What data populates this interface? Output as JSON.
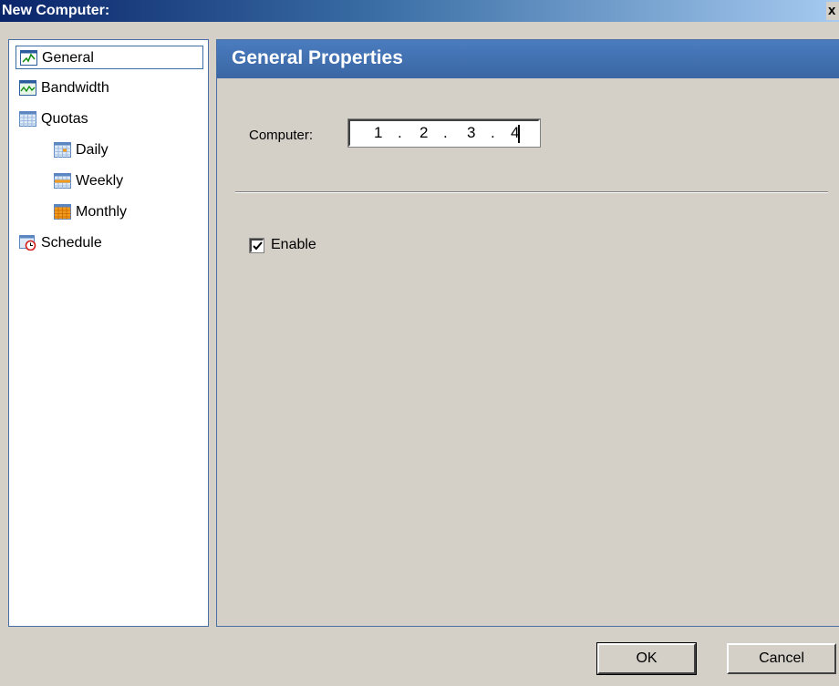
{
  "window": {
    "title": "New Computer:",
    "close_label": "x"
  },
  "tree": {
    "items": [
      {
        "label": "General",
        "icon": "chart-icon",
        "selected": true
      },
      {
        "label": "Bandwidth",
        "icon": "bandwidth-icon"
      },
      {
        "label": "Quotas",
        "icon": "calendar-icon"
      },
      {
        "label": "Daily",
        "icon": "calendar-daily-icon"
      },
      {
        "label": "Weekly",
        "icon": "calendar-weekly-icon"
      },
      {
        "label": "Monthly",
        "icon": "calendar-monthly-icon"
      },
      {
        "label": "Schedule",
        "icon": "schedule-clock-icon"
      }
    ]
  },
  "panel": {
    "title": "General Properties",
    "computer_label": "Computer:",
    "ip": [
      "1",
      "2",
      "3",
      "4"
    ],
    "ip_separator": ".",
    "enable_label": "Enable",
    "enable_checked": true
  },
  "buttons": {
    "ok": "OK",
    "cancel": "Cancel"
  },
  "colors": {
    "title_bar": "#0a246a",
    "header": "#3a66a3",
    "face": "#d4d0c8"
  }
}
